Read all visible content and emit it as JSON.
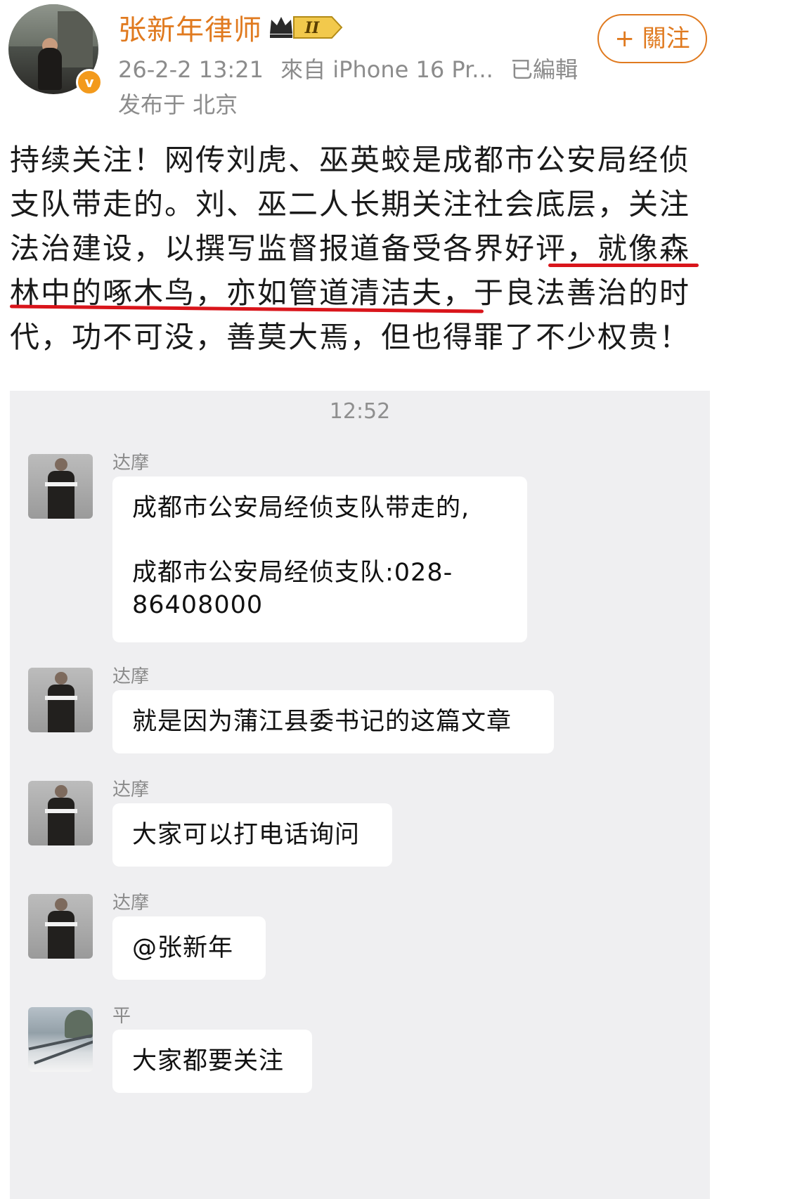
{
  "post": {
    "author": "张新年律师",
    "badge_level": "II",
    "timestamp": "26-2-2 13:21",
    "source": "來自 iPhone 16 Pr...",
    "edited": "已編輯",
    "location": "发布于 北京",
    "follow_label": "+ 關注",
    "text_lines": [
      "持续关注！网传刘虎、巫英蛟是成都市公安局经侦",
      "支队带走的。刘、巫二人长期关注社会底层，关注",
      "法治建设，以撰写监督报道备受各界好评，就像森",
      "林中的啄木鸟，亦如管道清洁夫，于良法善治的时",
      "代，功不可没，善莫大焉，但也得罪了不少权贵！"
    ]
  },
  "chat": {
    "time": "12:52",
    "messages": [
      {
        "sender": "达摩",
        "lines": [
          "成都市公安局经侦支队带走的,",
          "",
          "成都市公安局经侦支队:028-",
          "86408000"
        ]
      },
      {
        "sender": "达摩",
        "lines": [
          "就是因为蒲江县委书记的这篇文章"
        ]
      },
      {
        "sender": "达摩",
        "lines": [
          "大家可以打电话询问"
        ]
      },
      {
        "sender": "达摩",
        "lines": [
          "@张新年"
        ]
      },
      {
        "sender": "平",
        "lines": [
          "大家都要关注"
        ]
      }
    ]
  },
  "colors": {
    "author": "#e07a1f",
    "underline": "#d9151b",
    "chat_bg": "#efeff1"
  }
}
